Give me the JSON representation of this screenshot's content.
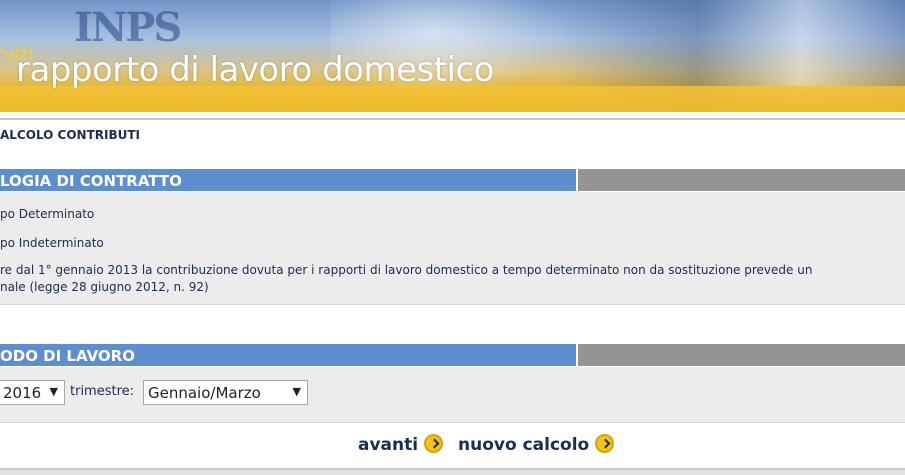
{
  "banner": {
    "logo": "INPS",
    "subtitle": "rvizi",
    "title": "rapporto di lavoro domestico"
  },
  "page": {
    "section_title": "ALCOLO CONTRIBUTI"
  },
  "contract": {
    "header": "LOGIA DI CONTRATTO",
    "options": [
      "po Determinato",
      "po Indeterminato"
    ],
    "note_lines": [
      "re dal 1° gennaio 2013 la contribuzione dovuta per i rapporti di lavoro domestico a tempo determinato non da sostituzione prevede un",
      "nale (legge 28 giugno 2012, n. 92)"
    ]
  },
  "period": {
    "header": "ODO DI LAVORO",
    "year_value": "2016",
    "quarter_label": "trimestre:",
    "quarter_value": "Gennaio/Marzo"
  },
  "actions": {
    "next_label": "avanti",
    "new_label": "nuovo calcolo"
  },
  "colors": {
    "header_blue": "#5d8ed0",
    "header_gray": "#949494",
    "panel_bg": "#ececec",
    "text_navy": "#1a2d52",
    "icon_yellow": "#f4c21f"
  },
  "icons": {
    "select_arrow": "chevron-down-icon",
    "go": "arrow-right-circle-icon"
  }
}
